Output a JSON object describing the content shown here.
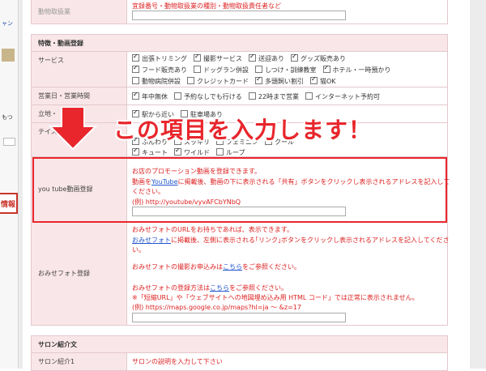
{
  "leftstrip": {
    "link_text": "ャン",
    "mo_text": "もつ",
    "tag_text": "情報"
  },
  "top_row": {
    "note": "宜録番号・動物取扱業の種別・動物取扱責任者など",
    "label": "動物取扱業"
  },
  "features_section": {
    "title": "特徴・動画登録"
  },
  "service": {
    "label": "サービス",
    "options_row1": [
      {
        "label": "出張トリミング",
        "checked": true
      },
      {
        "label": "撮影サービス",
        "checked": true
      },
      {
        "label": "送迎あり",
        "checked": true
      },
      {
        "label": "グッズ販売あり",
        "checked": true
      }
    ],
    "options_row2": [
      {
        "label": "フード販売あり",
        "checked": true
      },
      {
        "label": "ドッグラン併設",
        "checked": false
      },
      {
        "label": "しつけ・訓練教室",
        "checked": false
      },
      {
        "label": "ホテル・一時預かり",
        "checked": true
      }
    ],
    "options_row3": [
      {
        "label": "動物病院併設",
        "checked": false
      },
      {
        "label": "クレジットカード",
        "checked": false
      },
      {
        "label": "多頭飼い割引",
        "checked": true
      },
      {
        "label": "猫OK",
        "checked": true
      }
    ]
  },
  "hours": {
    "label": "営業日・営業時間",
    "options": [
      {
        "label": "年中無休",
        "checked": true
      },
      {
        "label": "予約なしでも行ける",
        "checked": false
      },
      {
        "label": "22時まで営業",
        "checked": false
      },
      {
        "label": "インターネット予約可",
        "checked": false
      }
    ]
  },
  "location": {
    "label": "立地・",
    "options": [
      {
        "label": "駅から近い",
        "checked": true
      },
      {
        "label": "駐車場あり",
        "checked": false
      }
    ]
  },
  "taste": {
    "label": "テイスト",
    "options_row1": [
      {
        "label": "ふんわり",
        "checked": true
      },
      {
        "label": "スッキリ",
        "checked": false
      },
      {
        "label": "フェミニン",
        "checked": false
      },
      {
        "label": "クール",
        "checked": true
      }
    ],
    "options_row2": [
      {
        "label": "キュート",
        "checked": true
      },
      {
        "label": "ワイルド",
        "checked": true
      },
      {
        "label": "ループ",
        "checked": false
      }
    ]
  },
  "callout": {
    "text": "この項目を入力します！",
    "color": "#e8262c"
  },
  "youtube": {
    "label": "you tube動画登録",
    "line1": "お店のプロモーション動画を登録できます。",
    "line2_pre": "動画を",
    "line2_link": "YouTube",
    "line2_post": "に掲載後、動画の下に表示される「共有」ボタンをクリックし表示されるアドレスを記入して",
    "line3": "ください。",
    "example": "(例) http://youtube/vyvAFCbYNbQ",
    "value": ""
  },
  "omise": {
    "label": "おみせフォト登録",
    "line1": "おみせフォトのURLをお持ちであれば、表示できます。",
    "line2_link": "おみせフォト",
    "line2_post": "に掲載後、左側に表示される｢リンク｣ボタンをクリックし表示されるアドレスを記入してくださ",
    "line3": "い。",
    "line4_pre": "おみせフォトの撮影お申込みは",
    "line4_link": "こちら",
    "line4_post": "をご参照ください。",
    "line5_pre": "おみせフォトの登録方法は",
    "line5_link": "こちら",
    "line5_post": "をご参照ください。",
    "line6": "※「短縮URL」や「ウェブサイトへの地図埋め込み用 HTML コード」では正常に表示されません。",
    "line7": "(例) https://maps.google.co.jp/maps?hl=ja 〜 &z=17",
    "value": ""
  },
  "salon_section": {
    "title": "サロン紹介文"
  },
  "salon_intro": {
    "label": "サロン紹介1",
    "note": "サロンの説明を入力して下さい"
  }
}
